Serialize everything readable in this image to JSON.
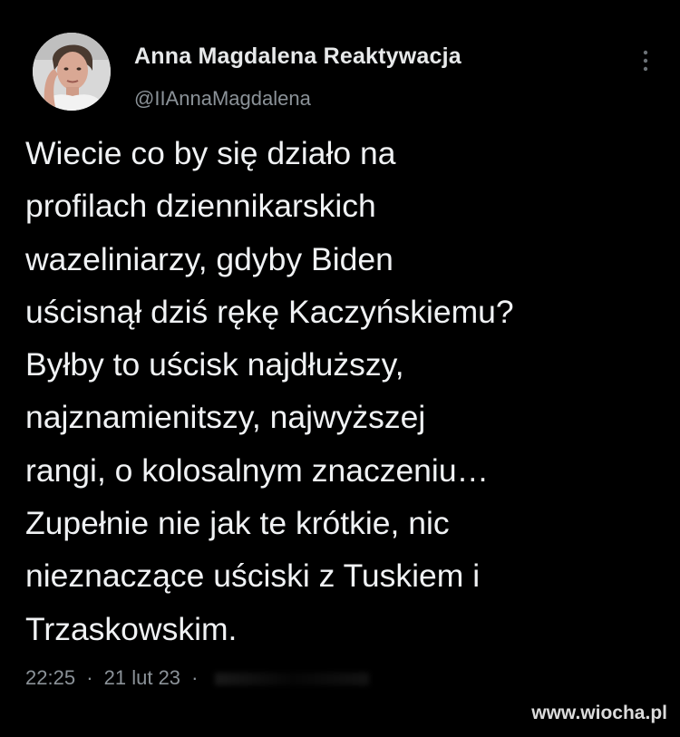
{
  "author": {
    "display_name": "Anna Magdalena Reaktywacja",
    "handle": "@IIAnnaMagdalena"
  },
  "tweet": {
    "lines": [
      "Wiecie co by się działo na",
      "profilach dziennikarskich",
      "wazeliniarzy, gdyby Biden",
      "uścisnął dziś rękę Kaczyńskiemu?",
      "Byłby to uścisk najdłuższy,",
      "najznamienitszy, najwyższej",
      "rangi, o kolosalnym znaczeniu…",
      "Zupełnie nie jak te krótkie, nic",
      "nieznaczące uściski z Tuskiem i",
      "Trzaskowskim."
    ],
    "time": "22:25",
    "separator": "·",
    "date": "21 lut 23",
    "separator_2": "·"
  },
  "watermark": {
    "text": "www.wiocha.pl"
  },
  "icons": {
    "more": "more-vertical-icon",
    "avatar": "profile-avatar"
  },
  "colors": {
    "background": "#000000",
    "text": "#f0f2f4",
    "secondary_text": "#8b9298"
  }
}
